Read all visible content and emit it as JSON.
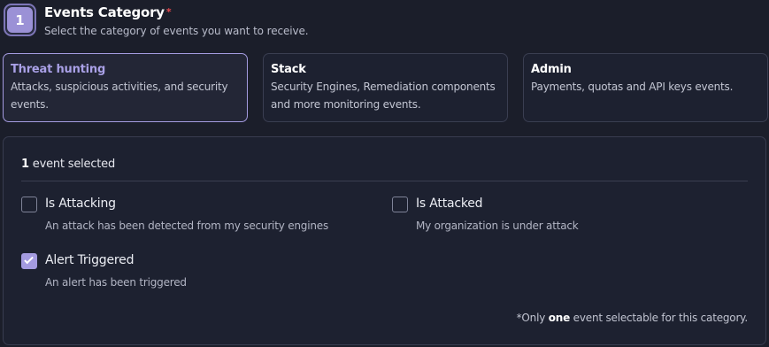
{
  "step": {
    "number": "1",
    "title": "Events Category",
    "required_marker": "*",
    "subtitle": "Select the category of events you want to receive."
  },
  "categories": [
    {
      "title": "Threat hunting",
      "description": "Attacks, suspicious activities, and security events.",
      "selected": true
    },
    {
      "title": "Stack",
      "description": "Security Engines, Remediation components and more monitoring events.",
      "selected": false
    },
    {
      "title": "Admin",
      "description": "Payments, quotas and API keys events.",
      "selected": false
    }
  ],
  "events_panel": {
    "count_number": "1",
    "count_suffix": " event selected",
    "events": [
      {
        "label": "Is Attacking",
        "description": "An attack has been detected from my security engines",
        "checked": false
      },
      {
        "label": "Is Attacked",
        "description": "My organization is under attack",
        "checked": false
      },
      {
        "label": "Alert Triggered",
        "description": "An alert has been triggered",
        "checked": true
      }
    ],
    "footnote": {
      "prefix": "*Only ",
      "emphasis": "one",
      "suffix": " event selectable for this category."
    }
  },
  "colors": {
    "accent": "#a49be0",
    "background": "#1b1e2a",
    "required": "#e5484d"
  },
  "icons": {
    "checkmark": "check-icon"
  }
}
